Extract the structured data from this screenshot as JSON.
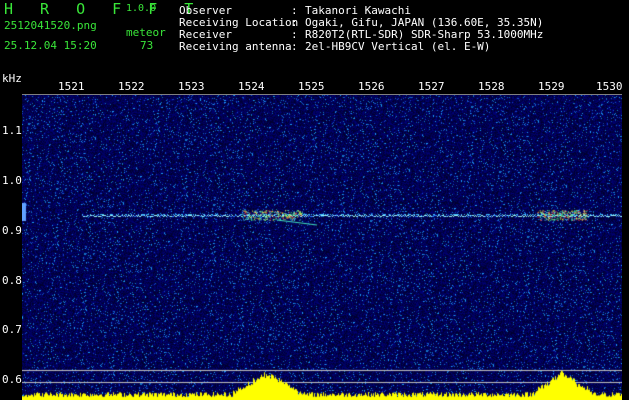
{
  "header": {
    "app_name": "H R O F F T",
    "version": "1.0.0",
    "filename": "2512041520.png",
    "meteor_label": "meteor",
    "datetime": "25.12.04 15:20",
    "meteor_count": "73"
  },
  "info": [
    {
      "key": "Observer",
      "value": "Takanori Kawachi"
    },
    {
      "key": "Receiving Location",
      "value": "Ogaki, Gifu, JAPAN (136.60E, 35.35N)"
    },
    {
      "key": "Receiver",
      "value": "R820T2(RTL-SDR) SDR-Sharp 53.1000MHz"
    },
    {
      "key": "Receiving antenna",
      "value": "2el-HB9CV Vertical (el. E-W)"
    }
  ],
  "axes": {
    "y_unit": "kHz",
    "x_ticks": [
      "1521",
      "1522",
      "1523",
      "1524",
      "1525",
      "1526",
      "1527",
      "1528",
      "1529",
      "1530"
    ],
    "y_ticks": [
      "1.1",
      "1.0",
      "0.9",
      "0.8",
      "0.7",
      "0.6"
    ]
  },
  "colors": {
    "background": "#000000",
    "header_green": "#39e639",
    "info_white": "#ffffff",
    "spectrogram_base": "#0a0a80",
    "echo_line": "#80ffff",
    "peak": "#ff3030",
    "level_bar": "#ffff00"
  }
}
